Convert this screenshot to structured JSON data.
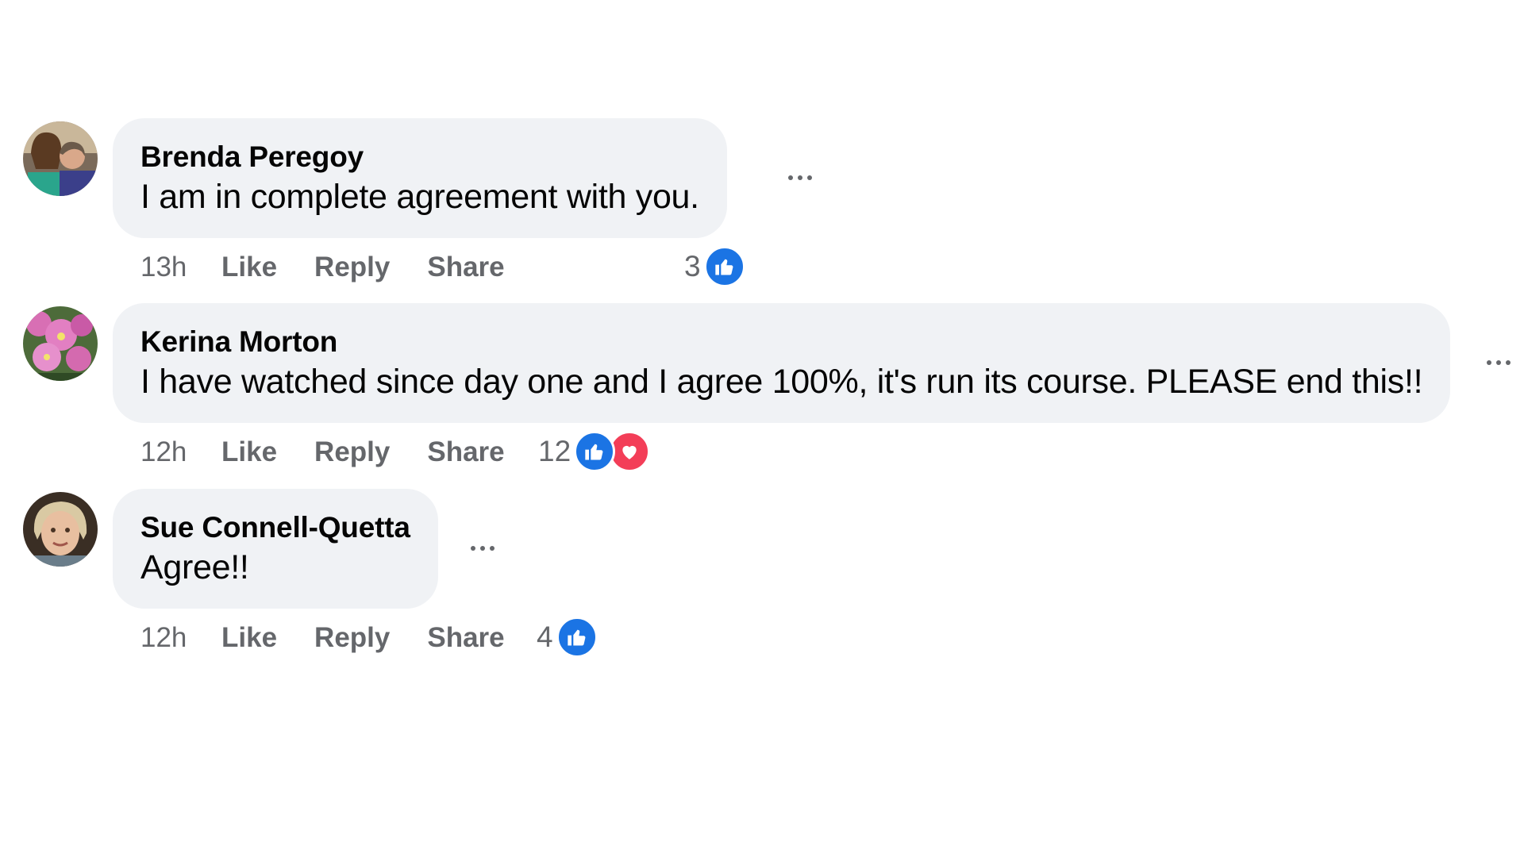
{
  "comments": [
    {
      "author": "Brenda Peregoy",
      "text": "I am in complete agreement with you.",
      "time": "13h",
      "like_label": "Like",
      "reply_label": "Reply",
      "share_label": "Share",
      "reaction_count": "3",
      "reactions": [
        "like"
      ]
    },
    {
      "author": "Kerina Morton",
      "text": "I have watched since day one and I agree 100%, it's run its course. PLEASE end this!!",
      "time": "12h",
      "like_label": "Like",
      "reply_label": "Reply",
      "share_label": "Share",
      "reaction_count": "12",
      "reactions": [
        "like",
        "love"
      ]
    },
    {
      "author": "Sue Connell-Quetta",
      "text": "Agree!!",
      "time": "12h",
      "like_label": "Like",
      "reply_label": "Reply",
      "share_label": "Share",
      "reaction_count": "4",
      "reactions": [
        "like"
      ]
    }
  ],
  "colors": {
    "bubble": "#f0f2f5",
    "like_blue": "#1b74e4",
    "love_red": "#f33e58",
    "meta_gray": "#65676b"
  }
}
